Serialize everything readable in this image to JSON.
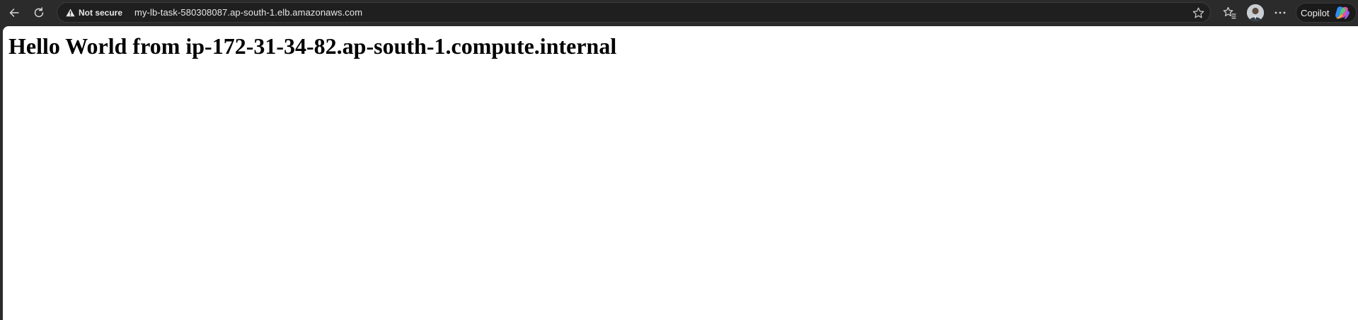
{
  "browser": {
    "security_label": "Not secure",
    "url": "my-lb-task-580308087.ap-south-1.elb.amazonaws.com",
    "copilot_label": "Copilot",
    "icons": {
      "back": "back-arrow-icon",
      "refresh": "refresh-icon",
      "warning": "warning-triangle-icon",
      "favorite": "star-icon",
      "favorites": "favorites-icon",
      "more": "more-options-icon",
      "copilot": "copilot-logo-icon"
    },
    "colors": {
      "toolbar": "#2b2b2b",
      "address_bar": "#1f1f1f",
      "page_background": "#ffffff"
    }
  },
  "page": {
    "heading": "Hello World from ip-172-31-34-82.ap-south-1.compute.internal"
  }
}
